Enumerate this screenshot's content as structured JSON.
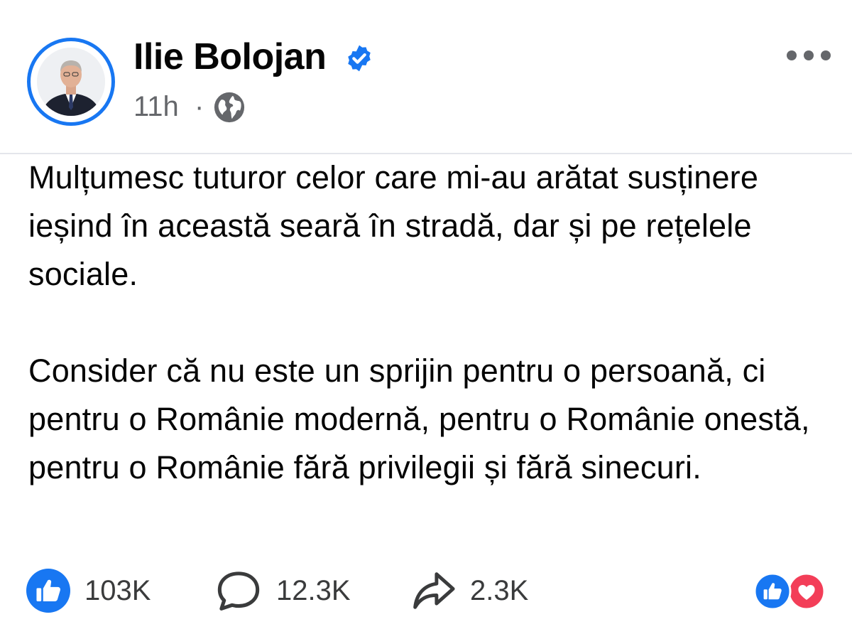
{
  "author": {
    "name": "Ilie Bolojan",
    "verified": true
  },
  "meta": {
    "time": "11h",
    "separator": "·",
    "audience_icon": "globe-icon"
  },
  "post": {
    "paragraphs": [
      "Mulțumesc tuturor celor care mi-au arătat susținere ieșind în această seară în stradă, dar și pe rețelele sociale.",
      "Consider că nu este un sprijin pentru o persoană, ci pentru o Românie modernă, pentru o Românie onestă, pentru o Românie fără privilegii și fără sinecuri."
    ]
  },
  "stats": {
    "likes": "103K",
    "comments": "12.3K",
    "shares": "2.3K"
  },
  "icons": {
    "like": "like-icon",
    "comment": "comment-icon",
    "share": "share-icon",
    "more": "more-options-icon",
    "reactions": [
      "like-reaction-icon",
      "love-reaction-icon"
    ]
  },
  "colors": {
    "brand_blue": "#1877f2",
    "love_red": "#f33e58",
    "secondary_text": "#65676b"
  }
}
